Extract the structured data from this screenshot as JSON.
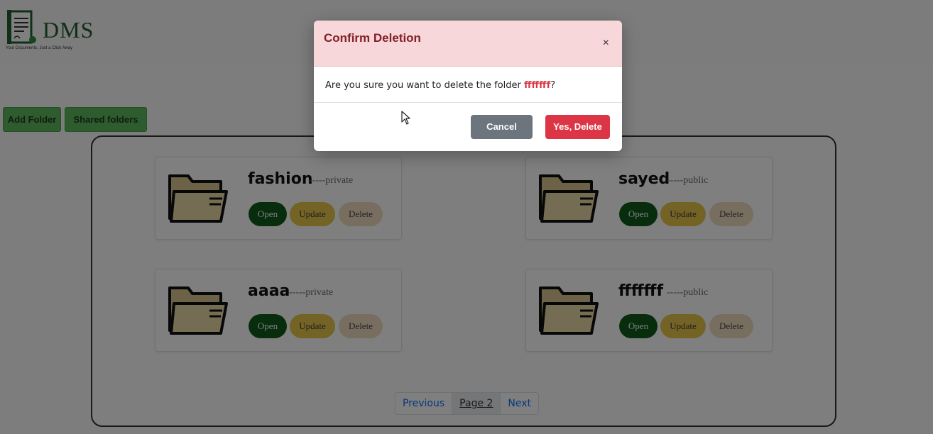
{
  "app": {
    "logo_text": "DMS",
    "logo_tagline": "Your Documents, Just a Click Away"
  },
  "toolbar": {
    "add_folder_label": "Add Folder",
    "shared_folders_label": "Shared folders"
  },
  "folders": [
    {
      "name": "fashion",
      "visibility": "-----private",
      "open": "Open",
      "update": "Update",
      "delete": "Delete"
    },
    {
      "name": "sayed",
      "visibility": "-----public",
      "open": "Open",
      "update": "Update",
      "delete": "Delete"
    },
    {
      "name": "aaaa",
      "visibility": "-----private",
      "open": "Open",
      "update": "Update",
      "delete": "Delete"
    },
    {
      "name": "fffffff",
      "visibility": "-----public",
      "open": "Open",
      "update": "Update",
      "delete": "Delete"
    }
  ],
  "pagination": {
    "previous": "Previous",
    "current": "Page 2",
    "next": "Next"
  },
  "modal": {
    "title": "Confirm Deletion",
    "close_symbol": "×",
    "message_prefix": "Are you sure you want to delete the folder ",
    "folder_name": "fffffff",
    "message_suffix": "?",
    "cancel_label": "Cancel",
    "confirm_label": "Yes, Delete"
  },
  "colors": {
    "open_button": "#0e5a1a",
    "update_button": "#e6c64a",
    "delete_button": "#f0ddc0",
    "danger": "#dc3545",
    "secondary": "#6c757d",
    "modal_header": "#f8d7da",
    "green_action": "#5cb85c"
  }
}
